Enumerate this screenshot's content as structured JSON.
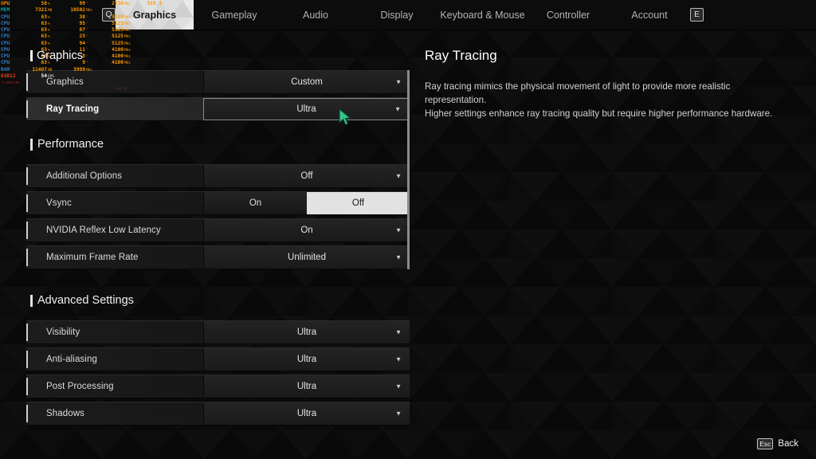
{
  "tabbar": {
    "left_key": "Q",
    "right_key": "E",
    "tabs": [
      {
        "label": "Graphics",
        "active": true
      },
      {
        "label": "Gameplay",
        "active": false
      },
      {
        "label": "Audio",
        "active": false
      },
      {
        "label": "Display",
        "active": false
      },
      {
        "label": "Keyboard & Mouse",
        "active": false
      },
      {
        "label": "Controller",
        "active": false
      },
      {
        "label": "Account",
        "active": false
      }
    ]
  },
  "settings": {
    "groups": [
      {
        "title": "Graphics",
        "rows": [
          {
            "label": "Graphics",
            "value": "Custom",
            "type": "dropdown",
            "selected": false
          },
          {
            "label": "Ray Tracing",
            "value": "Ultra",
            "type": "dropdown",
            "selected": true
          }
        ]
      },
      {
        "title": "Performance",
        "rows": [
          {
            "label": "Additional Options",
            "value": "Off",
            "type": "dropdown",
            "selected": false
          },
          {
            "label": "Vsync",
            "type": "segmented",
            "options": [
              "On",
              "Off"
            ],
            "value": "Off",
            "selected": false
          },
          {
            "label": "NVIDIA Reflex Low Latency",
            "value": "On",
            "type": "dropdown",
            "selected": false
          },
          {
            "label": "Maximum Frame Rate",
            "value": "Unlimited",
            "type": "dropdown",
            "selected": false
          }
        ]
      },
      {
        "title": "Advanced Settings",
        "rows": [
          {
            "label": "Visibility",
            "value": "Ultra",
            "type": "dropdown",
            "selected": false
          },
          {
            "label": "Anti-aliasing",
            "value": "Ultra",
            "type": "dropdown",
            "selected": false
          },
          {
            "label": "Post Processing",
            "value": "Ultra",
            "type": "dropdown",
            "selected": false
          },
          {
            "label": "Shadows",
            "value": "Ultra",
            "type": "dropdown",
            "selected": false
          }
        ]
      }
    ]
  },
  "description": {
    "title": "Ray Tracing",
    "body": "Ray tracing mimics the physical movement of light to provide more realistic representation.\nHigher settings enhance ray tracing quality but require higher performance hardware."
  },
  "bottom_hint": {
    "key": "Esc",
    "label": "Back"
  },
  "overlay_title": "Graphics",
  "stats_overlay": {
    "rows": [
      {
        "name": "GPU",
        "v1": "58",
        "u1": "%",
        "v2": "99",
        "u2": "'",
        "v3": "2730",
        "u3": "MHz",
        "v4": "319.3",
        "u4": "'"
      },
      {
        "name": "MEM",
        "v1": "7321",
        "u1": "MB",
        "v2": "10502",
        "u2": "MHz",
        "v3": "",
        "u3": "",
        "v4": "",
        "u4": ""
      },
      {
        "name": "CPU",
        "v1": "63",
        "u1": "%",
        "v2": "38",
        "u2": "'",
        "v3": "5125",
        "u3": "MHz",
        "v4": "",
        "u4": ""
      },
      {
        "name": "CPU",
        "v1": "63",
        "u1": "%",
        "v2": "95",
        "u2": "'",
        "v3": "5125",
        "u3": "MHz",
        "v4": "",
        "u4": ""
      },
      {
        "name": "CPU",
        "v1": "63",
        "u1": "%",
        "v2": "87",
        "u2": "'",
        "v3": "5125",
        "u3": "MHz",
        "v4": "",
        "u4": ""
      },
      {
        "name": "CPU",
        "v1": "63",
        "u1": "%",
        "v2": "23",
        "u2": "'",
        "v3": "5125",
        "u3": "MHz",
        "v4": "",
        "u4": ""
      },
      {
        "name": "CPU",
        "v1": "63",
        "u1": "%",
        "v2": "94",
        "u2": "'",
        "v3": "5125",
        "u3": "MHz",
        "v4": "",
        "u4": ""
      },
      {
        "name": "CPU",
        "v1": "63",
        "u1": "%",
        "v2": "11",
        "u2": "'",
        "v3": "4100",
        "u3": "MHz",
        "v4": "",
        "u4": ""
      },
      {
        "name": "CPU",
        "v1": "63",
        "u1": "%",
        "v2": "8",
        "u2": "'",
        "v3": "4100",
        "u3": "MHz",
        "v4": "",
        "u4": ""
      },
      {
        "name": "CPU",
        "v1": "63",
        "u1": "%",
        "v2": "9",
        "u2": "'",
        "v3": "4100",
        "u3": "MHz",
        "v4": "",
        "u4": ""
      },
      {
        "name": "RAM",
        "v1": "11407",
        "u1": "MB",
        "v2": "3999",
        "u2": "MHz",
        "v3": "",
        "u3": "",
        "v4": "",
        "u4": ""
      }
    ],
    "fps_label": "D3D12",
    "fps_value": "54",
    "fps_unit": "FPS",
    "frametime_label": "Frametime"
  },
  "colors": {
    "accent_orange": "#ff9a00",
    "cursor_green": "#2fc58a",
    "toggle_on_bg": "#e2e2e2",
    "panel_bg": "#161616"
  }
}
